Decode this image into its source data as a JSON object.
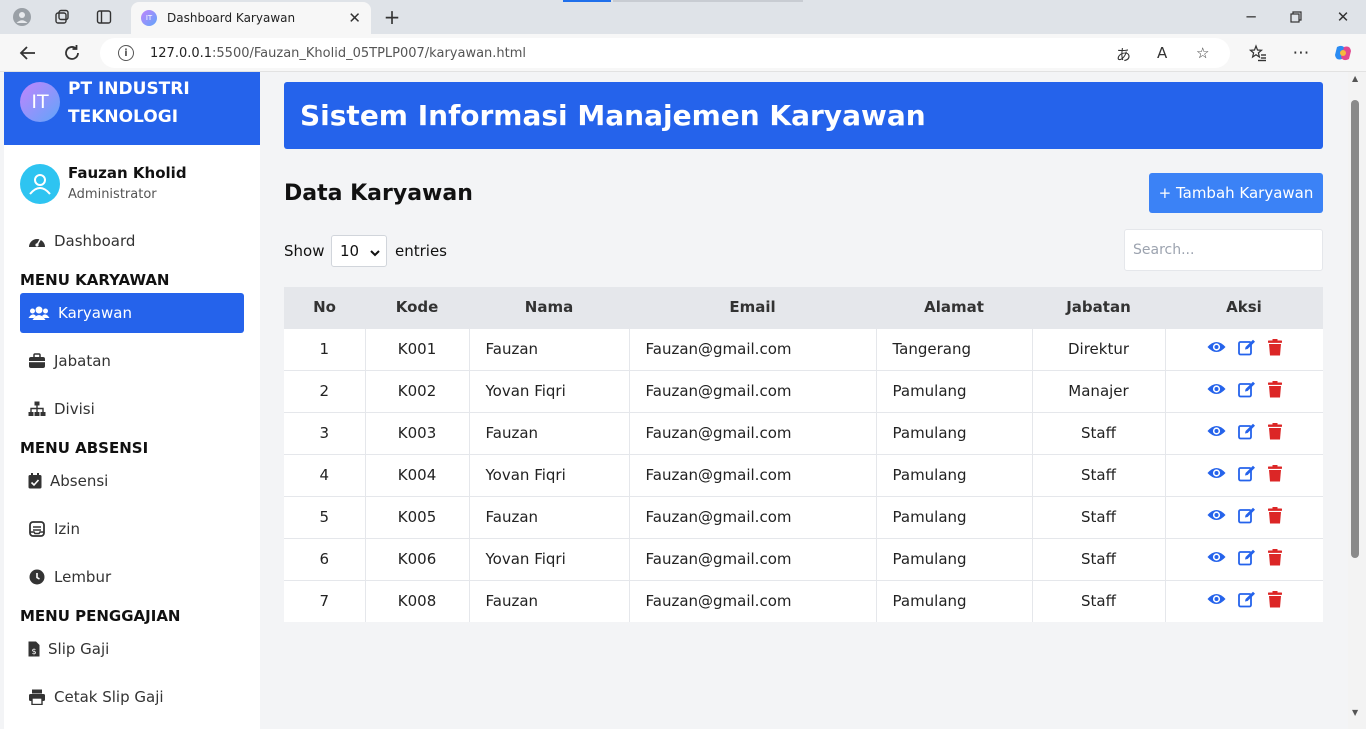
{
  "browser": {
    "tab_title": "Dashboard Karyawan",
    "tab_favicon": "IT",
    "url_host": "127.0.0.1",
    "url_path": ":5500/Fauzan_Kholid_05TPLP007/karyawan.html"
  },
  "sidebar": {
    "brand_logo": "IT",
    "brand_name": "PT INDUSTRI TEKNOLOGI",
    "user_name": "Fauzan Kholid",
    "user_role": "Administrator",
    "dashboard": "Dashboard",
    "section_karyawan": "MENU KARYAWAN",
    "karyawan": "Karyawan",
    "jabatan": "Jabatan",
    "divisi": "Divisi",
    "section_absensi": "MENU ABSENSI",
    "absensi": "Absensi",
    "izin": "Izin",
    "lembur": "Lembur",
    "section_penggajian": "MENU PENGGAJIAN",
    "slip_gaji": "Slip Gaji",
    "cetak_slip_gaji": "Cetak Slip Gaji"
  },
  "main": {
    "header_title": "Sistem Informasi Manajemen Karyawan",
    "section_title": "Data Karyawan",
    "add_button": "+ Tambah Karyawan",
    "show_label": "Show",
    "entries_value": "10",
    "entries_label": "entries",
    "search_placeholder": "Search..."
  },
  "table": {
    "headers": [
      "No",
      "Kode",
      "Nama",
      "Email",
      "Alamat",
      "Jabatan",
      "Aksi"
    ],
    "rows": [
      [
        "1",
        "K001",
        "Fauzan",
        "Fauzan@gmail.com",
        "Tangerang",
        "Direktur"
      ],
      [
        "2",
        "K002",
        "Yovan Fiqri",
        "Fauzan@gmail.com",
        "Pamulang",
        "Manajer"
      ],
      [
        "3",
        "K003",
        "Fauzan",
        "Fauzan@gmail.com",
        "Pamulang",
        "Staff"
      ],
      [
        "4",
        "K004",
        "Yovan Fiqri",
        "Fauzan@gmail.com",
        "Pamulang",
        "Staff"
      ],
      [
        "5",
        "K005",
        "Fauzan",
        "Fauzan@gmail.com",
        "Pamulang",
        "Staff"
      ],
      [
        "6",
        "K006",
        "Yovan Fiqri",
        "Fauzan@gmail.com",
        "Pamulang",
        "Staff"
      ],
      [
        "7",
        "K008",
        "Fauzan",
        "Fauzan@gmail.com",
        "Pamulang",
        "Staff"
      ]
    ]
  },
  "colors": {
    "primary": "#2563eb",
    "button": "#3b82f6",
    "delete": "#dc2626",
    "avatar": "#2ec4f1"
  },
  "icons": {
    "view": "eye-icon",
    "edit": "edit-icon",
    "delete": "trash-icon"
  }
}
